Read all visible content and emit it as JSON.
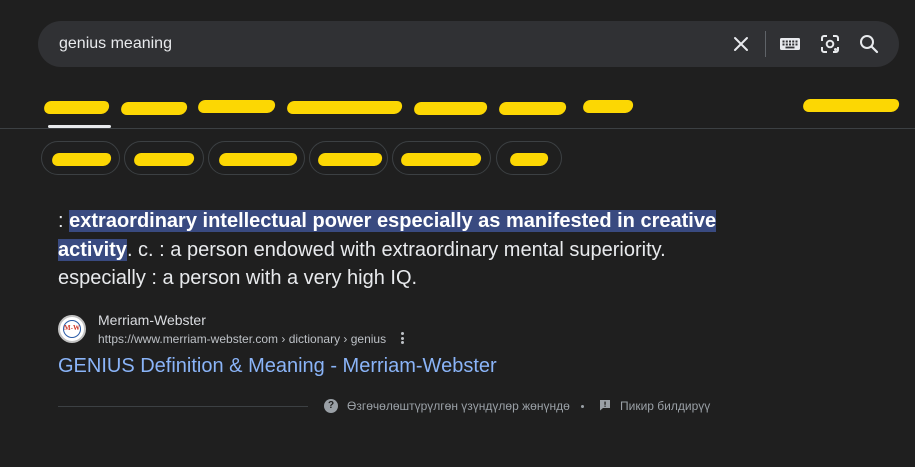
{
  "search": {
    "query": "genius meaning",
    "icons": [
      "close-icon",
      "keyboard-icon",
      "lens-icon",
      "search-icon"
    ]
  },
  "colors": {
    "background": "#1f1f1f",
    "searchbar": "#303134",
    "highlight": "#394a80",
    "link": "#8ab4f8",
    "redaction": "#fcd703"
  },
  "definition": {
    "prefix": ": ",
    "highlight_1": "extraordinary intellectual power especially as manifested in creative",
    "highlight_2": "activity",
    "rest": ". c. : a person endowed with extraordinary mental superiority. especially : a person with a very high IQ."
  },
  "source": {
    "icon_text": "M-W",
    "name": "Merriam-Webster",
    "url": "https://www.merriam-webster.com › dictionary › genius",
    "title": "GENIUS Definition & Meaning - Merriam-Webster"
  },
  "footer": {
    "about_snippets": "Өзгөчөлөштүрүлгөн үзүндүлөр жөнүндө",
    "feedback": "Пикир билдирүү"
  }
}
